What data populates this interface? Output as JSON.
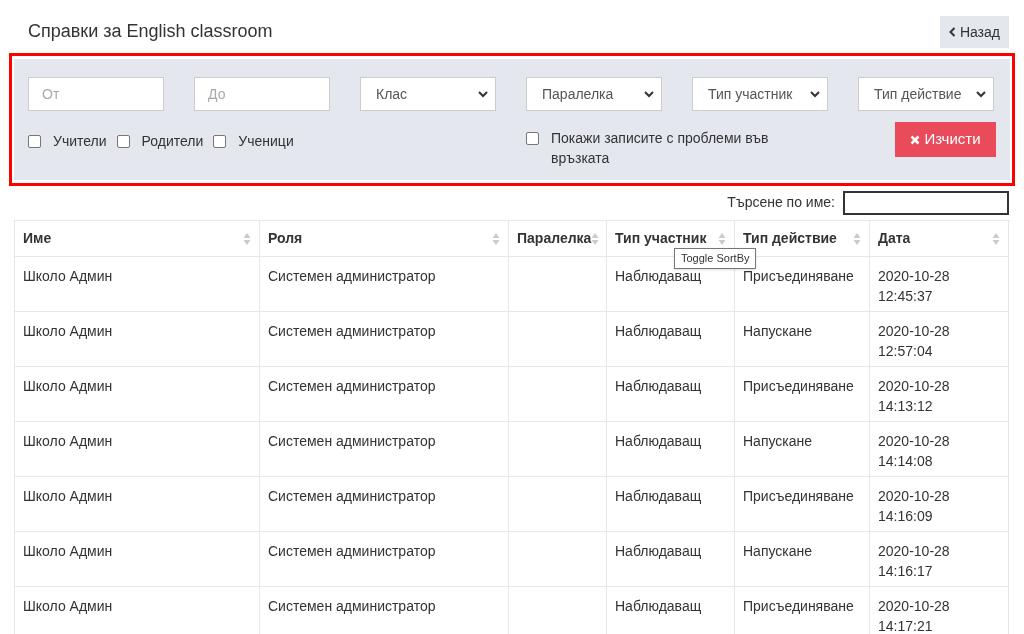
{
  "title": "Справки за English classroom",
  "back_button": {
    "label": "Назад"
  },
  "filters": {
    "fields": [
      {
        "placeholder": "От"
      },
      {
        "placeholder": "До"
      }
    ],
    "selects": [
      {
        "label": "Клас"
      },
      {
        "label": "Паралелка"
      },
      {
        "label": "Тип участник"
      },
      {
        "label": "Тип действие"
      }
    ],
    "role_checkboxes": [
      {
        "label": "Учители",
        "checked": false
      },
      {
        "label": "Родители",
        "checked": false
      },
      {
        "label": "Ученици",
        "checked": false
      }
    ],
    "problem_checkbox": {
      "label": "Покажи записите с проблеми във връзката",
      "checked": false
    },
    "clear_button": {
      "label": "Изчисти"
    }
  },
  "search": {
    "label": "Търсене по име:"
  },
  "tooltip": "Toggle SortBy",
  "table": {
    "columns": [
      "Име",
      "Роля",
      "Паралелка",
      "Тип участник",
      "Тип действие",
      "Дата"
    ],
    "rows": [
      [
        "Школо Админ",
        "Системен администратор",
        "",
        "Наблюдаващ",
        "Присъединяване",
        "2020-10-28 12:45:37"
      ],
      [
        "Школо Админ",
        "Системен администратор",
        "",
        "Наблюдаващ",
        "Напускане",
        "2020-10-28 12:57:04"
      ],
      [
        "Школо Админ",
        "Системен администратор",
        "",
        "Наблюдаващ",
        "Присъединяване",
        "2020-10-28 14:13:12"
      ],
      [
        "Школо Админ",
        "Системен администратор",
        "",
        "Наблюдаващ",
        "Напускане",
        "2020-10-28 14:14:08"
      ],
      [
        "Школо Админ",
        "Системен администратор",
        "",
        "Наблюдаващ",
        "Присъединяване",
        "2020-10-28 14:16:09"
      ],
      [
        "Школо Админ",
        "Системен администратор",
        "",
        "Наблюдаващ",
        "Напускане",
        "2020-10-28 14:16:17"
      ],
      [
        "Школо Админ",
        "Системен администратор",
        "",
        "Наблюдаващ",
        "Присъединяване",
        "2020-10-28 14:17:21"
      ]
    ]
  }
}
